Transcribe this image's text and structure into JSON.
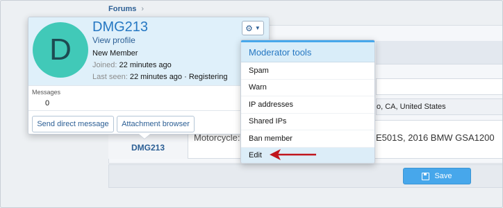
{
  "breadcrumb": {
    "item": "Forums"
  },
  "background": {
    "location_text": "o, CA, United States",
    "username": "DMG213",
    "motorcycle_label": "Motorcycle:",
    "motorcycle_value": "E501S, 2016 BMW GSA1200",
    "save_label": "Save"
  },
  "card": {
    "avatar_letter": "D",
    "username": "DMG213",
    "view_profile": "View profile",
    "user_title": "New Member",
    "joined_label": "Joined:",
    "joined_value": "22 minutes ago",
    "last_seen_label": "Last seen:",
    "last_seen_value": "22 minutes ago · Registering",
    "messages_label": "Messages",
    "messages_count": "0",
    "send_dm": "Send direct message",
    "attachment_browser": "Attachment browser"
  },
  "menu": {
    "title": "Moderator tools",
    "items": [
      "Spam",
      "Warn",
      "IP addresses",
      "Shared IPs",
      "Ban member",
      "Edit"
    ]
  },
  "colors": {
    "accent": "#47a7eb",
    "link": "#2b5e94",
    "avatar": "#41c9b8",
    "arrow": "#c0141c"
  }
}
